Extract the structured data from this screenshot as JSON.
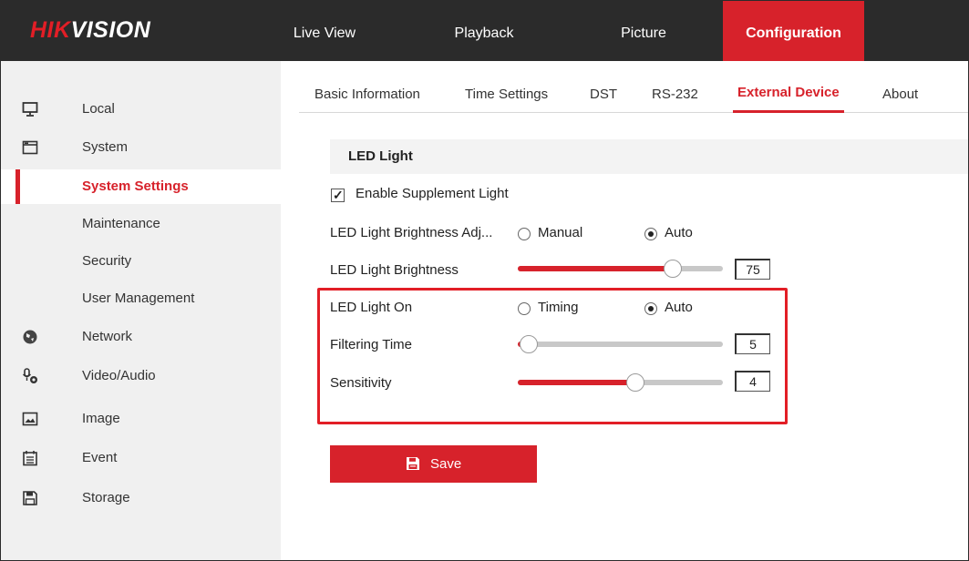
{
  "header": {
    "logo_red": "HIK",
    "logo_white": "VISION",
    "tabs": [
      {
        "label": "Live View"
      },
      {
        "label": "Playback"
      },
      {
        "label": "Picture"
      },
      {
        "label": "Configuration"
      }
    ]
  },
  "sidebar": {
    "items": [
      {
        "label": "Local",
        "icon": "monitor-icon"
      },
      {
        "label": "System",
        "icon": "system-icon"
      },
      {
        "label": "System Settings"
      },
      {
        "label": "Maintenance"
      },
      {
        "label": "Security"
      },
      {
        "label": "User Management"
      },
      {
        "label": "Network",
        "icon": "globe-icon"
      },
      {
        "label": "Video/Audio",
        "icon": "microphone-camera-icon"
      },
      {
        "label": "Image",
        "icon": "image-icon"
      },
      {
        "label": "Event",
        "icon": "calendar-icon"
      },
      {
        "label": "Storage",
        "icon": "floppy-disk-icon"
      }
    ]
  },
  "subnav": {
    "tabs": [
      {
        "label": "Basic Information"
      },
      {
        "label": "Time Settings"
      },
      {
        "label": "DST"
      },
      {
        "label": "RS-232"
      },
      {
        "label": "External Device"
      },
      {
        "label": "About"
      }
    ]
  },
  "form": {
    "section_title": "LED Light",
    "enable_label": "Enable Supplement Light",
    "enable_checked": true,
    "brightness_adj_label": "LED Light Brightness Adj...",
    "brightness_adj_options": [
      "Manual",
      "Auto"
    ],
    "brightness_adj_selected": "Auto",
    "brightness_label": "LED Light Brightness",
    "brightness_value": "75",
    "light_on_label": "LED Light On",
    "light_on_options": [
      "Timing",
      "Auto"
    ],
    "light_on_selected": "Auto",
    "filtering_label": "Filtering Time",
    "filtering_value": "5",
    "sensitivity_label": "Sensitivity",
    "sensitivity_value": "4",
    "save_label": "Save"
  },
  "sliders": {
    "brightness_fraction": 0.75,
    "filtering_fraction": 0.05,
    "sensitivity_fraction": 0.57
  },
  "colors": {
    "accent": "#d7222b",
    "header_bg": "#2b2b2b",
    "sidebar_bg": "#f0f0f0"
  }
}
